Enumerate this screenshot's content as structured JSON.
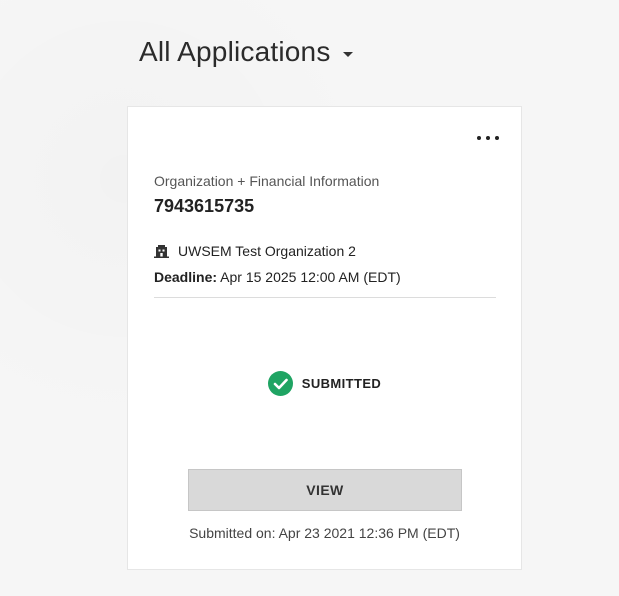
{
  "header": {
    "title": "All Applications"
  },
  "card": {
    "application_type": "Organization + Financial Information",
    "application_id": "7943615735",
    "organization_icon": "building-icon",
    "organization_name": "UWSEM Test Organization 2",
    "deadline_label": "Deadline:",
    "deadline_value": "Apr 15 2025 12:00 AM (EDT)",
    "status_icon": "check-circle-icon",
    "status_color": "#1fa463",
    "status_label": "SUBMITTED",
    "view_label": "VIEW",
    "submitted_on": "Submitted on: Apr 23 2021 12:36 PM (EDT)"
  }
}
